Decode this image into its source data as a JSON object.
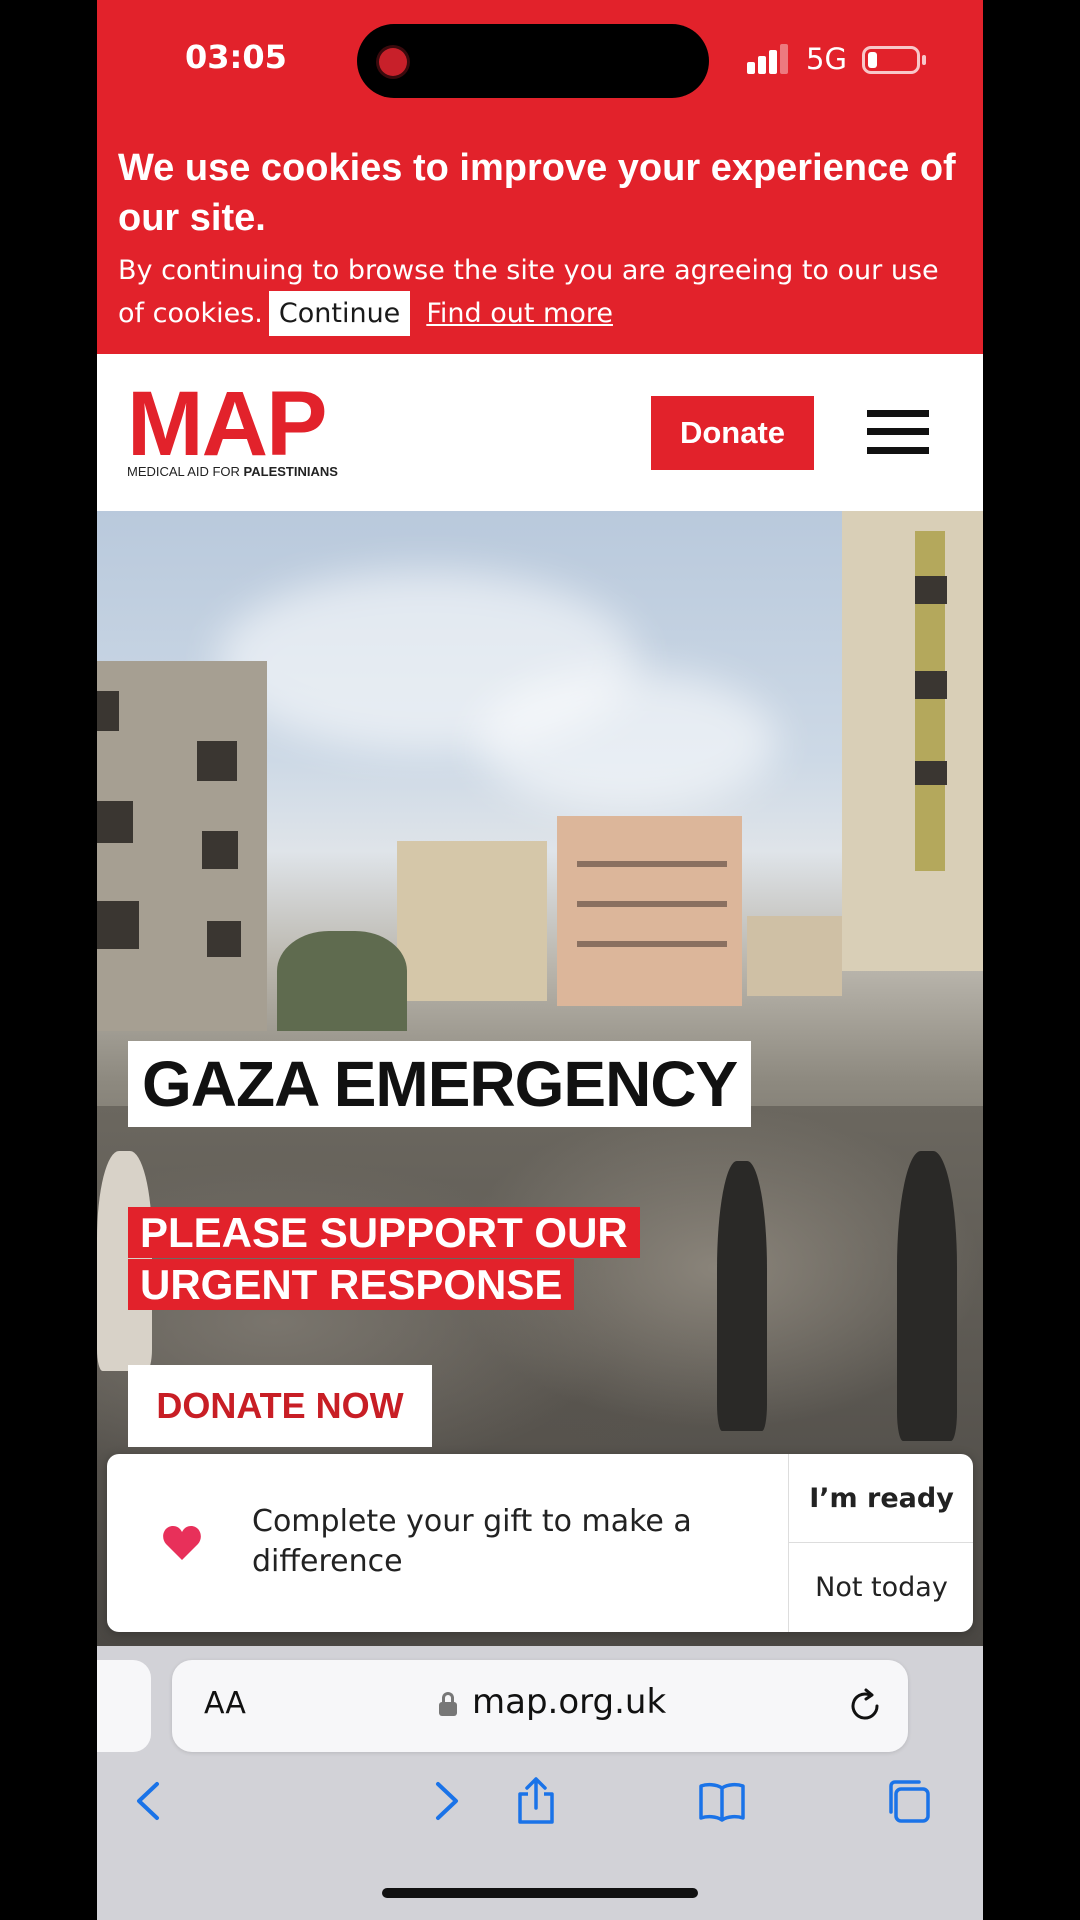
{
  "status_bar": {
    "time": "03:05",
    "network": "5G",
    "icons": [
      "signal-icon",
      "battery-icon"
    ]
  },
  "cookie_banner": {
    "title": "We use cookies to improve your experience of our site.",
    "text": "By continuing to browse the site you are agreeing to our use of cookies.",
    "continue_label": "Continue",
    "find_out_label": "Find out more",
    "background": "#e2222b"
  },
  "header": {
    "logo_text": "MAP",
    "logo_sub_regular": "MEDICAL AID FOR ",
    "logo_sub_bold": "PALESTINIANS",
    "donate_label": "Donate",
    "menu_icon": "hamburger-menu-icon",
    "brand_color": "#e2222b"
  },
  "hero": {
    "title": "GAZA EMERGENCY",
    "subtitle": "PLEASE SUPPORT OUR URGENT RESPONSE",
    "cta_label": "DONATE NOW"
  },
  "gift_prompt": {
    "icon": "heart-icon",
    "text": "Complete your gift to make a difference",
    "ready_label": "I’m ready",
    "not_today_label": "Not today"
  },
  "browser": {
    "text_size_label": "AA",
    "url": "map.org.uk",
    "icons": [
      "lock-icon",
      "reload-icon",
      "back-icon",
      "forward-icon",
      "share-icon",
      "bookmarks-icon",
      "tabs-icon"
    ]
  }
}
